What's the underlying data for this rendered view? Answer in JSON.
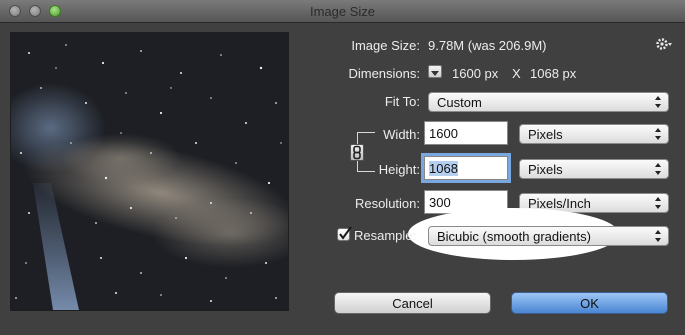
{
  "window": {
    "title": "Image Size"
  },
  "image_size": {
    "label": "Image Size:",
    "value": "9.78M (was 206.9M)"
  },
  "dimensions": {
    "label": "Dimensions:",
    "width": "1600 px",
    "separator": "X",
    "height": "1068 px"
  },
  "fit_to": {
    "label": "Fit To:",
    "value": "Custom"
  },
  "width": {
    "label": "Width:",
    "value": "1600",
    "unit": "Pixels"
  },
  "height": {
    "label": "Height:",
    "value": "1068",
    "unit": "Pixels"
  },
  "resolution": {
    "label": "Resolution:",
    "value": "300",
    "unit": "Pixels/Inch"
  },
  "resample": {
    "label": "Resample:",
    "checked": true,
    "value": "Bicubic (smooth gradients)"
  },
  "buttons": {
    "cancel": "Cancel",
    "ok": "OK"
  },
  "icons": [
    "gear-icon",
    "chain-link-icon",
    "disclosure-icon",
    "popup-arrows-icon",
    "checkmark-icon"
  ],
  "colors": {
    "window_bg": "#404040",
    "ok_button": "#4a86d4",
    "highlight_oval": "#ffffff"
  }
}
